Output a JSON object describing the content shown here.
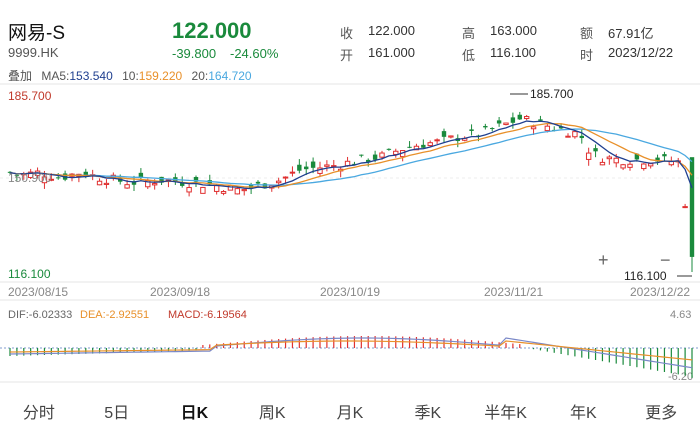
{
  "stock": {
    "name": "网易-S",
    "code": "9999.HK",
    "price": "122.000",
    "change": "-39.800",
    "change_pct": "-24.60%"
  },
  "stats": {
    "close_label": "收",
    "close": "122.000",
    "high_label": "高",
    "high": "163.000",
    "amount_label": "额",
    "amount": "67.91亿",
    "open_label": "开",
    "open": "161.000",
    "low_label": "低",
    "low": "116.100",
    "time_label": "时",
    "time": "2023/12/22"
  },
  "ma": {
    "overlay_label": "叠加",
    "ma5_label": "MA5:",
    "ma5": "153.540",
    "ma10_label": "10:",
    "ma10": "159.220",
    "ma20_label": "20:",
    "ma20": "164.720"
  },
  "price_axis": {
    "top": "185.700",
    "mid": "150.900",
    "bottom": "116.100",
    "max_marker": "185.700",
    "min_marker": "116.100"
  },
  "dates": [
    "2023/08/15",
    "2023/09/18",
    "2023/10/19",
    "2023/11/21",
    "2023/12/22"
  ],
  "macd": {
    "dif_label": "DIF:",
    "dif": "-6.02333",
    "dea_label": "DEA:",
    "dea": "-2.92551",
    "macd_label": "MACD:",
    "macd": "-6.19564",
    "top": "4.63",
    "bottom": "-6.20"
  },
  "zoom": {
    "plus": "+",
    "minus": "−"
  },
  "tabs": [
    "分时",
    "5日",
    "日K",
    "周K",
    "月K",
    "季K",
    "半年K",
    "年K",
    "更多"
  ],
  "colors": {
    "up": "#e03030",
    "down": "#1a8a3c",
    "ma5": "#1f3f8f",
    "ma10": "#e8902a",
    "ma20": "#4aa8e0"
  }
}
